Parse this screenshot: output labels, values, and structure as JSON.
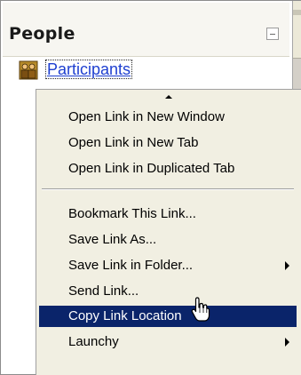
{
  "sidebar": {
    "title": "People",
    "link": "Participants",
    "collapse_icon": "minus-box-icon",
    "people_icon": "people-icon"
  },
  "context_menu": {
    "scroll_up_icon": "scroll-up-arrow-icon",
    "groups": [
      [
        {
          "label": "Open Link in New Window",
          "has_submenu": false
        },
        {
          "label": "Open Link in New Tab",
          "has_submenu": false
        },
        {
          "label": "Open Link in Duplicated Tab",
          "has_submenu": false
        }
      ],
      [
        {
          "label": "Bookmark This Link...",
          "has_submenu": false
        },
        {
          "label": "Save Link As...",
          "has_submenu": false
        },
        {
          "label": "Save Link in Folder...",
          "has_submenu": true
        },
        {
          "label": "Send Link...",
          "has_submenu": false
        },
        {
          "label": "Copy Link Location",
          "has_submenu": false,
          "selected": true
        },
        {
          "label": "Launchy",
          "has_submenu": true
        }
      ]
    ]
  },
  "colors": {
    "selection": "#0a246a",
    "menu_bg": "#f1efe2",
    "link": "#1e3fd0"
  },
  "cursor_icon": "hand-pointer-icon"
}
